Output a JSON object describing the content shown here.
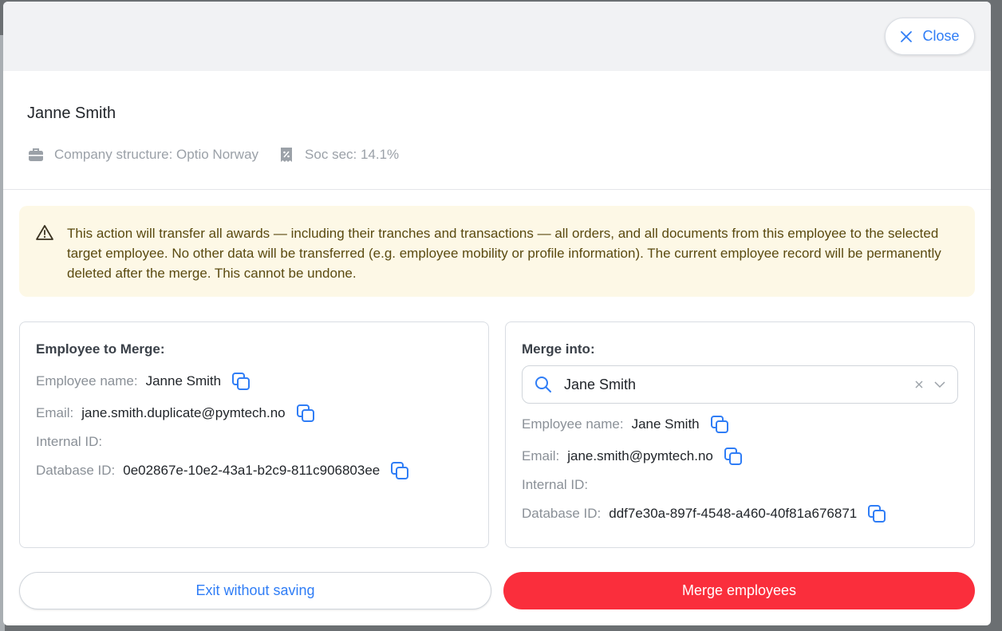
{
  "header": {
    "close_label": "Close"
  },
  "person": {
    "name": "Janne Smith",
    "company_structure": "Company structure: Optio Norway",
    "soc_sec": "Soc sec: 14.1%"
  },
  "warning": {
    "text": "This action will transfer all awards — including their tranches and transactions — all orders, and all documents from this employee to the selected target employee. No other data will be transferred (e.g. employee mobility or profile information). The current employee record will be permanently deleted after the merge. This cannot be undone."
  },
  "source": {
    "title": "Employee to Merge:",
    "name_label": "Employee name:",
    "name_value": "Janne Smith",
    "email_label": "Email:",
    "email_value": "jane.smith.duplicate@pymtech.no",
    "internal_id_label": "Internal ID:",
    "database_id_label": "Database ID:",
    "database_id_value": "0e02867e-10e2-43a1-b2c9-811c906803ee"
  },
  "target": {
    "title": "Merge into:",
    "select_value": "Jane Smith",
    "name_label": "Employee name:",
    "name_value": "Jane Smith",
    "email_label": "Email:",
    "email_value": "jane.smith@pymtech.no",
    "internal_id_label": "Internal ID:",
    "database_id_label": "Database ID:",
    "database_id_value": "ddf7e30a-897f-4548-a460-40f81a676871"
  },
  "actions": {
    "exit_label": "Exit without saving",
    "merge_label": "Merge employees"
  },
  "colors": {
    "accent": "#2f7df6",
    "danger": "#fa2e3c",
    "warning_bg": "#fdf8e6"
  },
  "icons": [
    "close-icon",
    "briefcase-icon",
    "receipt-percent-icon",
    "warning-icon",
    "copy-icon",
    "search-icon",
    "clear-icon",
    "chevron-down-icon"
  ]
}
